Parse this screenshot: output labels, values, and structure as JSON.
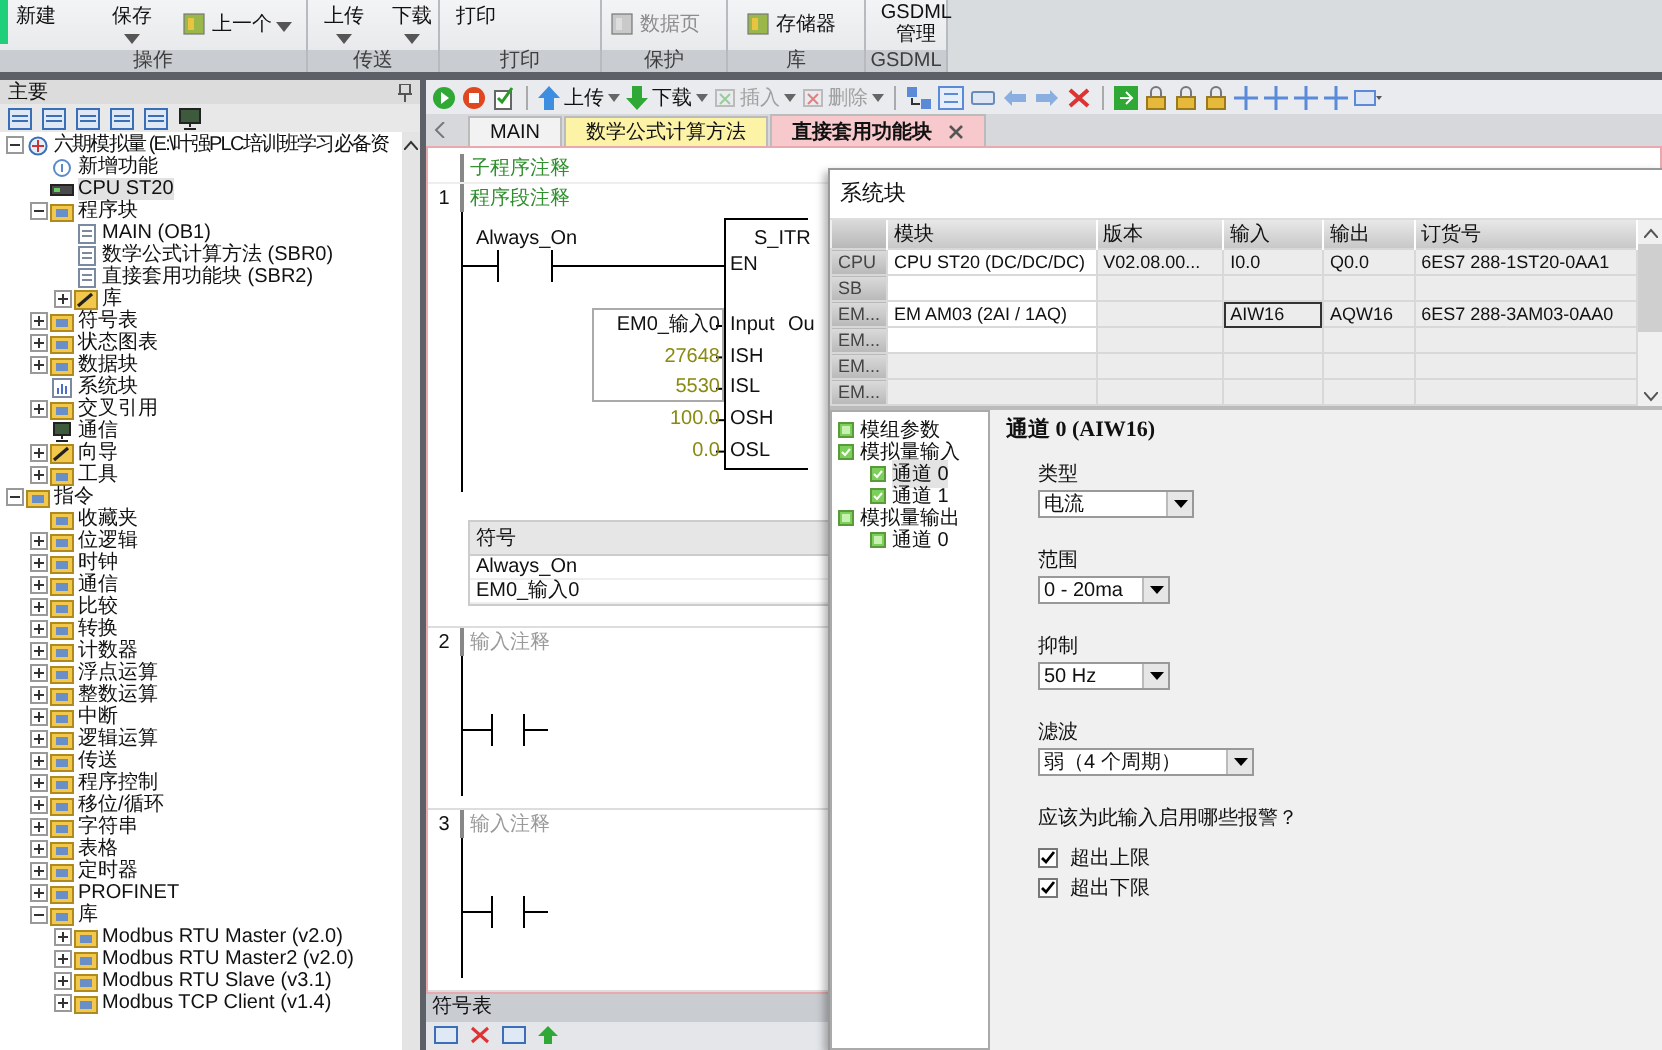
{
  "ribbon": {
    "groups": [
      {
        "label": "操作",
        "buttons": [
          {
            "label": "新建",
            "kind": "text",
            "dropdown": false,
            "disabled": false
          },
          {
            "label": "保存",
            "kind": "text",
            "dropdown": true,
            "disabled": false
          },
          {
            "label": "上一个",
            "kind": "icon",
            "dropdown": true,
            "disabled": false
          }
        ]
      },
      {
        "label": "传送",
        "buttons": [
          {
            "label": "上传",
            "kind": "text",
            "dropdown": true,
            "disabled": false
          },
          {
            "label": "下载",
            "kind": "text",
            "dropdown": true,
            "disabled": false
          }
        ]
      },
      {
        "label": "打印",
        "buttons": [
          {
            "label": "打印",
            "kind": "text",
            "dropdown": false,
            "disabled": false
          }
        ]
      },
      {
        "label": "保护",
        "buttons": [
          {
            "label": "数据页",
            "kind": "icon",
            "dropdown": false,
            "disabled": true
          }
        ]
      },
      {
        "label": "库",
        "buttons": [
          {
            "label": "存储器",
            "kind": "icon",
            "dropdown": false,
            "disabled": false
          }
        ]
      },
      {
        "label": "GSDML",
        "buttons": [
          {
            "label": "GSDML 管理",
            "kind": "text",
            "dropdown": false,
            "disabled": false
          }
        ]
      }
    ]
  },
  "panel": {
    "title": "主要",
    "tree": [
      {
        "label": "六期模拟量 (E:\\叶强PLC培训班学习必备资",
        "kind": "root",
        "selected": false,
        "expanded": true,
        "children": [
          {
            "label": "新增功能",
            "kind": "new",
            "selected": false
          },
          {
            "label": "CPU ST20",
            "kind": "cpu",
            "selected": true
          },
          {
            "label": "程序块",
            "kind": "folder",
            "selected": false,
            "expanded": true,
            "children": [
              {
                "label": "MAIN (OB1)",
                "kind": "doc",
                "selected": false
              },
              {
                "label": "数学公式计算方法 (SBR0)",
                "kind": "doc",
                "selected": false
              },
              {
                "label": "直接套用功能块 (SBR2)",
                "kind": "doc",
                "selected": false
              },
              {
                "label": "库",
                "kind": "wizard",
                "selected": false,
                "expanded": false
              }
            ]
          },
          {
            "label": "符号表",
            "kind": "folder",
            "selected": false,
            "expanded": false
          },
          {
            "label": "状态图表",
            "kind": "folder",
            "selected": false,
            "expanded": false
          },
          {
            "label": "数据块",
            "kind": "folder",
            "selected": false,
            "expanded": false
          },
          {
            "label": "系统块",
            "kind": "system",
            "selected": false
          },
          {
            "label": "交叉引用",
            "kind": "folder",
            "selected": false,
            "expanded": false
          },
          {
            "label": "通信",
            "kind": "comm",
            "selected": false
          },
          {
            "label": "向导",
            "kind": "wizard",
            "selected": false,
            "expanded": false
          },
          {
            "label": "工具",
            "kind": "folder",
            "selected": false,
            "expanded": false
          }
        ]
      },
      {
        "label": "指令",
        "kind": "folder",
        "selected": false,
        "expanded": true,
        "children": [
          {
            "label": "收藏夹",
            "kind": "folder",
            "selected": false
          },
          {
            "label": "位逻辑",
            "kind": "folder",
            "selected": false,
            "expanded": false
          },
          {
            "label": "时钟",
            "kind": "folder",
            "selected": false,
            "expanded": false
          },
          {
            "label": "通信",
            "kind": "folder",
            "selected": false,
            "expanded": false
          },
          {
            "label": "比较",
            "kind": "folder",
            "selected": false,
            "expanded": false
          },
          {
            "label": "转换",
            "kind": "folder",
            "selected": false,
            "expanded": false
          },
          {
            "label": "计数器",
            "kind": "folder",
            "selected": false,
            "expanded": false
          },
          {
            "label": "浮点运算",
            "kind": "folder",
            "selected": false,
            "expanded": false
          },
          {
            "label": "整数运算",
            "kind": "folder",
            "selected": false,
            "expanded": false
          },
          {
            "label": "中断",
            "kind": "folder",
            "selected": false,
            "expanded": false
          },
          {
            "label": "逻辑运算",
            "kind": "folder",
            "selected": false,
            "expanded": false
          },
          {
            "label": "传送",
            "kind": "folder",
            "selected": false,
            "expanded": false
          },
          {
            "label": "程序控制",
            "kind": "folder",
            "selected": false,
            "expanded": false
          },
          {
            "label": "移位/循环",
            "kind": "folder",
            "selected": false,
            "expanded": false
          },
          {
            "label": "字符串",
            "kind": "folder",
            "selected": false,
            "expanded": false
          },
          {
            "label": "表格",
            "kind": "folder",
            "selected": false,
            "expanded": false
          },
          {
            "label": "定时器",
            "kind": "folder",
            "selected": false,
            "expanded": false
          },
          {
            "label": "PROFINET",
            "kind": "folder",
            "selected": false,
            "expanded": false
          },
          {
            "label": "库",
            "kind": "folder",
            "selected": false,
            "expanded": true,
            "children": [
              {
                "label": "Modbus RTU Master (v2.0)",
                "kind": "folder",
                "selected": false,
                "expanded": false
              },
              {
                "label": "Modbus RTU Master2 (v2.0)",
                "kind": "folder",
                "selected": false,
                "expanded": false
              },
              {
                "label": "Modbus RTU Slave (v3.1)",
                "kind": "folder",
                "selected": false,
                "expanded": false
              },
              {
                "label": "Modbus TCP Client (v1.4)",
                "kind": "folder",
                "selected": false,
                "expanded": false
              }
            ]
          }
        ]
      }
    ]
  },
  "toolbar": {
    "buttons": [
      {
        "label": "上传",
        "disabled": false
      },
      {
        "label": "下载",
        "disabled": false
      },
      {
        "label": "插入",
        "disabled": true
      },
      {
        "label": "删除",
        "disabled": true
      }
    ]
  },
  "tabs": [
    {
      "label": "MAIN",
      "selected": false,
      "color": "#f2f2f2",
      "closable": false
    },
    {
      "label": "数学公式计算方法",
      "selected": false,
      "color": "#fdf3a6",
      "closable": false
    },
    {
      "label": "直接套用功能块",
      "selected": true,
      "color": "#f7c9cc",
      "closable": true
    }
  ],
  "editor": {
    "comment": "子程序注释",
    "networks": [
      {
        "number": "1",
        "comment": "程序段注释",
        "comment_placeholder": false,
        "kind": "block",
        "contact_label": "Always_On",
        "block": {
          "title": "S_ITR",
          "output": "Ou",
          "pins": [
            {
              "name": "EN"
            },
            {
              "name": "Input",
              "value": "EM0_输入0",
              "kind": "symbol"
            },
            {
              "name": "ISH",
              "value": "27648",
              "kind": "constant"
            },
            {
              "name": "ISL",
              "value": "5530",
              "kind": "constant"
            },
            {
              "name": "OSH",
              "value": "100.0",
              "kind": "constant"
            },
            {
              "name": "OSL",
              "value": "0.0",
              "kind": "constant"
            }
          ]
        },
        "symbols": {
          "header": "符号",
          "rows": [
            "Always_On",
            "EM0_输入0"
          ]
        }
      },
      {
        "number": "2",
        "comment": "输入注释",
        "comment_placeholder": true,
        "kind": "contact"
      },
      {
        "number": "3",
        "comment": "输入注释",
        "comment_placeholder": true,
        "kind": "contact"
      }
    ]
  },
  "symbol_pane": {
    "title": "符号表"
  },
  "dialog": {
    "title": "系统块",
    "table": {
      "columns": [
        "模块",
        "版本",
        "输入",
        "输出",
        "订货号"
      ],
      "rows": [
        {
          "slot": "CPU",
          "cells": [
            "CPU ST20 (DC/DC/DC)",
            "V02.08.00...",
            "I0.0",
            "Q0.0",
            "6ES7 288-1ST20-0AA1"
          ]
        },
        {
          "slot": "SB",
          "cells": [
            "",
            "",
            "",
            "",
            ""
          ]
        },
        {
          "slot": "EM...",
          "cells": [
            "EM AM03 (2AI / 1AQ)",
            "",
            "AIW16",
            "AQW16",
            "6ES7 288-3AM03-0AA0"
          ]
        },
        {
          "slot": "EM...",
          "cells": [
            "",
            "",
            "",
            "",
            ""
          ]
        },
        {
          "slot": "EM...",
          "cells": [
            "",
            "",
            "",
            "",
            ""
          ]
        },
        {
          "slot": "EM...",
          "cells": [
            "",
            "",
            "",
            "",
            ""
          ]
        }
      ]
    },
    "nav": [
      {
        "label": "模组参数",
        "checked": false,
        "selected": false
      },
      {
        "label": "模拟量输入",
        "checked": true,
        "selected": false,
        "expanded": true,
        "children": [
          {
            "label": "通道 0",
            "checked": true,
            "selected": true
          },
          {
            "label": "通道 1",
            "checked": true,
            "selected": false
          }
        ]
      },
      {
        "label": "模拟量输出",
        "checked": false,
        "selected": false,
        "expanded": true,
        "children": [
          {
            "label": "通道 0",
            "checked": false,
            "selected": false
          }
        ]
      }
    ],
    "heading": "通道 0 (AIW16)",
    "fields": [
      {
        "label": "类型",
        "value": "电流",
        "kind": "medium"
      },
      {
        "label": "范围",
        "value": "0 - 20ma",
        "kind": "short"
      },
      {
        "label": "抑制",
        "value": "50 Hz",
        "kind": "short"
      },
      {
        "label": "滤波",
        "value": "弱（4 个周期）",
        "kind": "long"
      }
    ],
    "question": "应该为此输入启用哪些报警？",
    "alarms": [
      {
        "label": "超出上限",
        "checked": true
      },
      {
        "label": "超出下限",
        "checked": true
      }
    ]
  }
}
